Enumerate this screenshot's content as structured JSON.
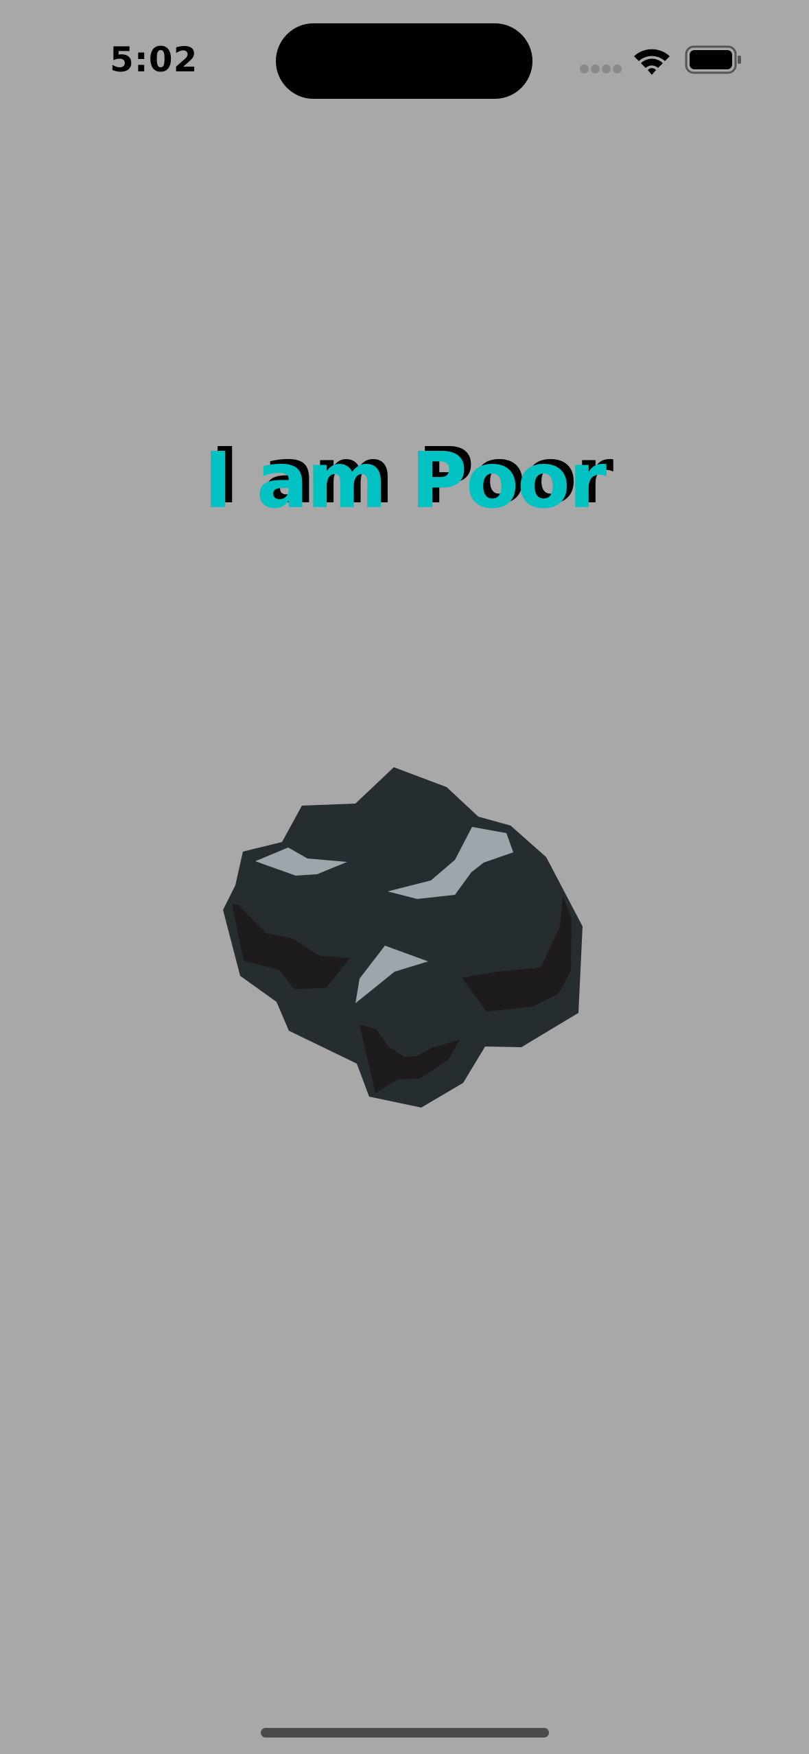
{
  "status_bar": {
    "time": "5:02",
    "icons": [
      "cellular-signal-icon",
      "wifi-icon",
      "battery-icon"
    ]
  },
  "main": {
    "headline": "I am Poor",
    "headline_color": "#00c2c2",
    "headline_shadow_color": "#000000",
    "image": "coal-lump"
  },
  "colors": {
    "background": "#a8a8a8",
    "coal_dark": "#252d30",
    "coal_highlight": "#9ea5ad",
    "coal_shadow": "#1e1b1c"
  }
}
